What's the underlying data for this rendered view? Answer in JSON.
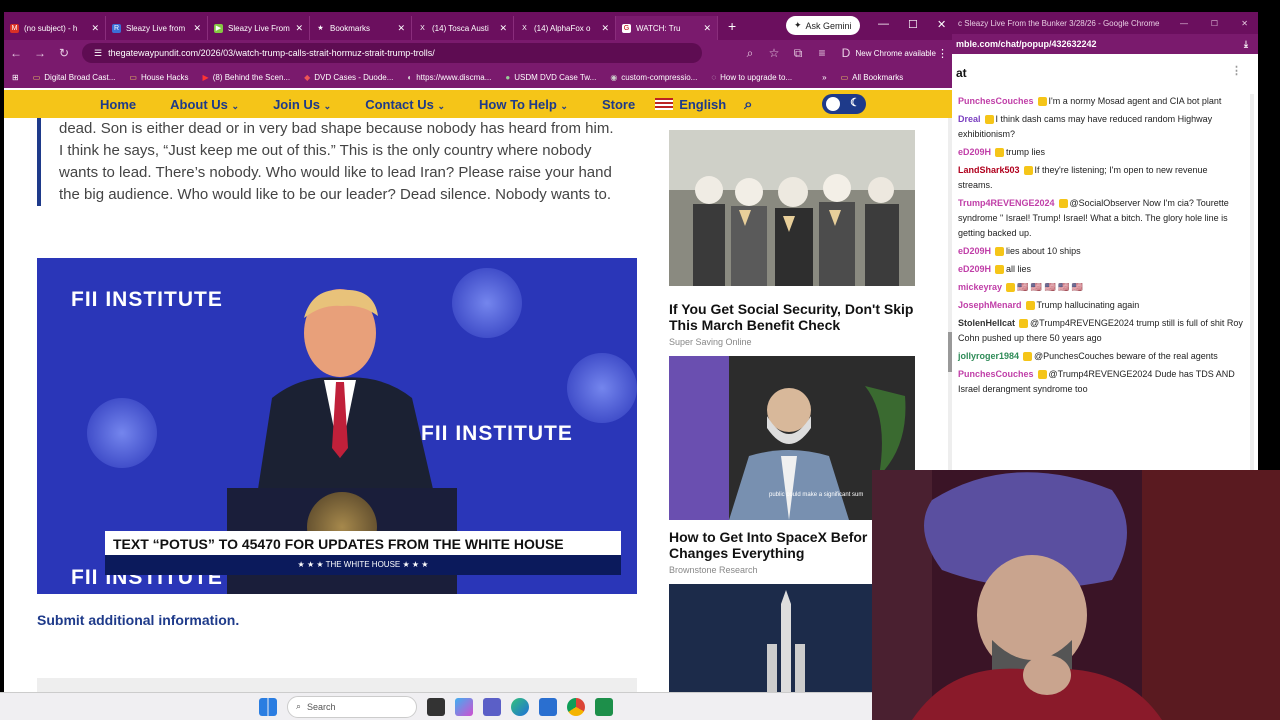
{
  "tabs": [
    {
      "label": "(no subject) - h",
      "icon": "gmail-icon"
    },
    {
      "label": "Sleazy Live from",
      "icon": "rumble-icon"
    },
    {
      "label": "Sleazy Live From",
      "icon": "rumble-icon"
    },
    {
      "label": "Bookmarks",
      "icon": "star-icon"
    },
    {
      "label": "(14) Tosca Austi",
      "icon": "x-icon"
    },
    {
      "label": "(14) AlphaFox o",
      "icon": "x-icon"
    },
    {
      "label": "WATCH: Tru",
      "icon": "gp-icon"
    }
  ],
  "gemini_label": "Ask Gemini",
  "url": "thegatewaypundit.com/2026/03/watch-trump-calls-strait-hormuz-strait-trump-trolls/",
  "profile_initial": "D",
  "new_chrome": "New Chrome available",
  "bookmarks": [
    "Digital Broad Cast...",
    "House Hacks",
    "(8) Behind the Scen...",
    "DVD Cases - Duode...",
    "https://www.discma...",
    "USDM DVD Case Tw...",
    "custom-compressio...",
    "How to upgrade to..."
  ],
  "all_bookmarks": "All Bookmarks",
  "site_nav": {
    "items": [
      "Home",
      "About Us",
      "Join Us",
      "Contact Us",
      "How To Help",
      "Store"
    ],
    "language": "English"
  },
  "article": {
    "quote": "dead. Son is either dead or in very bad shape because nobody has heard from him. I think he says, “Just keep me out of this.” This is the only country where nobody wants to lead. There’s nobody. Who would like to lead Iran? Please raise your hand the big audience. Who would like to be our leader? Dead silence. Nobody wants to.",
    "video": {
      "brand": "FII INSTITUTE",
      "chyron_text": "TEXT “POTUS” TO 45470 FOR UPDATES FROM THE WHITE HOUSE",
      "chyron_sub": "★ ★ ★  THE WHITE HOUSE  ★ ★ ★"
    },
    "submit_link": "Submit additional information."
  },
  "ads": [
    {
      "title": "If You Get Social Security, Don't Skip This March Benefit Check",
      "source": "Super Saving Online"
    },
    {
      "title": "How to Get Into SpaceX Befor Day Changes Everything",
      "source": "Brownstone Research",
      "caption": "public could make a significant sum"
    }
  ],
  "chat": {
    "window_title": "c Sleazy Live From the Bunker 3/28/26 - Google Chrome",
    "url": "mble.com/chat/popup/432632242",
    "heading": "at",
    "messages": [
      {
        "user": "PunchesCouches",
        "color": "#c03fa8",
        "text": "I'm a normy Mosad agent and CIA bot plant"
      },
      {
        "user": "Dreal",
        "color": "#7a3fc0",
        "text": "I think dash cams may have reduced random Highway exhibitionism?"
      },
      {
        "user": "eD209H",
        "color": "#c03fa8",
        "text": "trump lies"
      },
      {
        "user": "LandShark503",
        "color": "#b0001d",
        "text": "If they're listening; I'm open to new revenue streams."
      },
      {
        "user": "Trump4REVENGE2024",
        "color": "#c03fa8",
        "text": "@SocialObserver Now I'm cia? Tourette syndrome \" Israel! Trump! Israel! What a bitch. The glory hole line is getting backed up."
      },
      {
        "user": "eD209H",
        "color": "#c03fa8",
        "text": "lies about 10 ships"
      },
      {
        "user": "eD209H",
        "color": "#c03fa8",
        "text": "all lies"
      },
      {
        "user": "mickeyray",
        "color": "#c03fa8",
        "text": "🇺🇸 🇺🇸 🇺🇸 🇺🇸 🇺🇸"
      },
      {
        "user": "JosephMenard",
        "color": "#c03fa8",
        "text": "Trump hallucinating again"
      },
      {
        "user": "StolenHellcat",
        "color": "#333333",
        "text": "@Trump4REVENGE2024 trump still is full of shit Roy Cohn pushed up there 50 years ago"
      },
      {
        "user": "jollyroger1984",
        "color": "#2e8b57",
        "text": "@PunchesCouches beware of the real agents"
      },
      {
        "user": "PunchesCouches",
        "color": "#c03fa8",
        "text": "@Trump4REVENGE2024 Dude has TDS AND Israel derangment syndrome too"
      }
    ]
  },
  "taskbar": {
    "search": "Search"
  },
  "colors": {
    "chrome": "#6b0f5e",
    "nav": "#f5c518",
    "link": "#1e3a8a"
  }
}
